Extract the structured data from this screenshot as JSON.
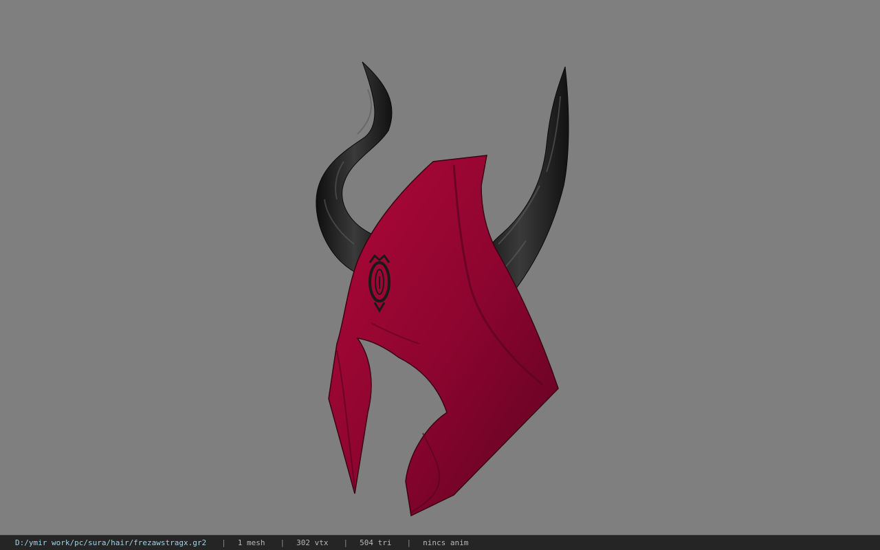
{
  "viewer": {
    "background_color": "#7f7f7f",
    "model": {
      "hood_color": "#9e0632",
      "hood_shadow_color": "#5a0420",
      "horn_color": "#1e1e1e",
      "emblem_color": "#1a1a1a"
    }
  },
  "status_bar": {
    "file_path": "D:/ymir work/pc/sura/hair/frezawstragx.gr2",
    "separator": "|",
    "mesh_count": "1 mesh",
    "vertex_count": "302 vtx",
    "triangle_count": "504 tri",
    "animation": "nincs anim"
  }
}
